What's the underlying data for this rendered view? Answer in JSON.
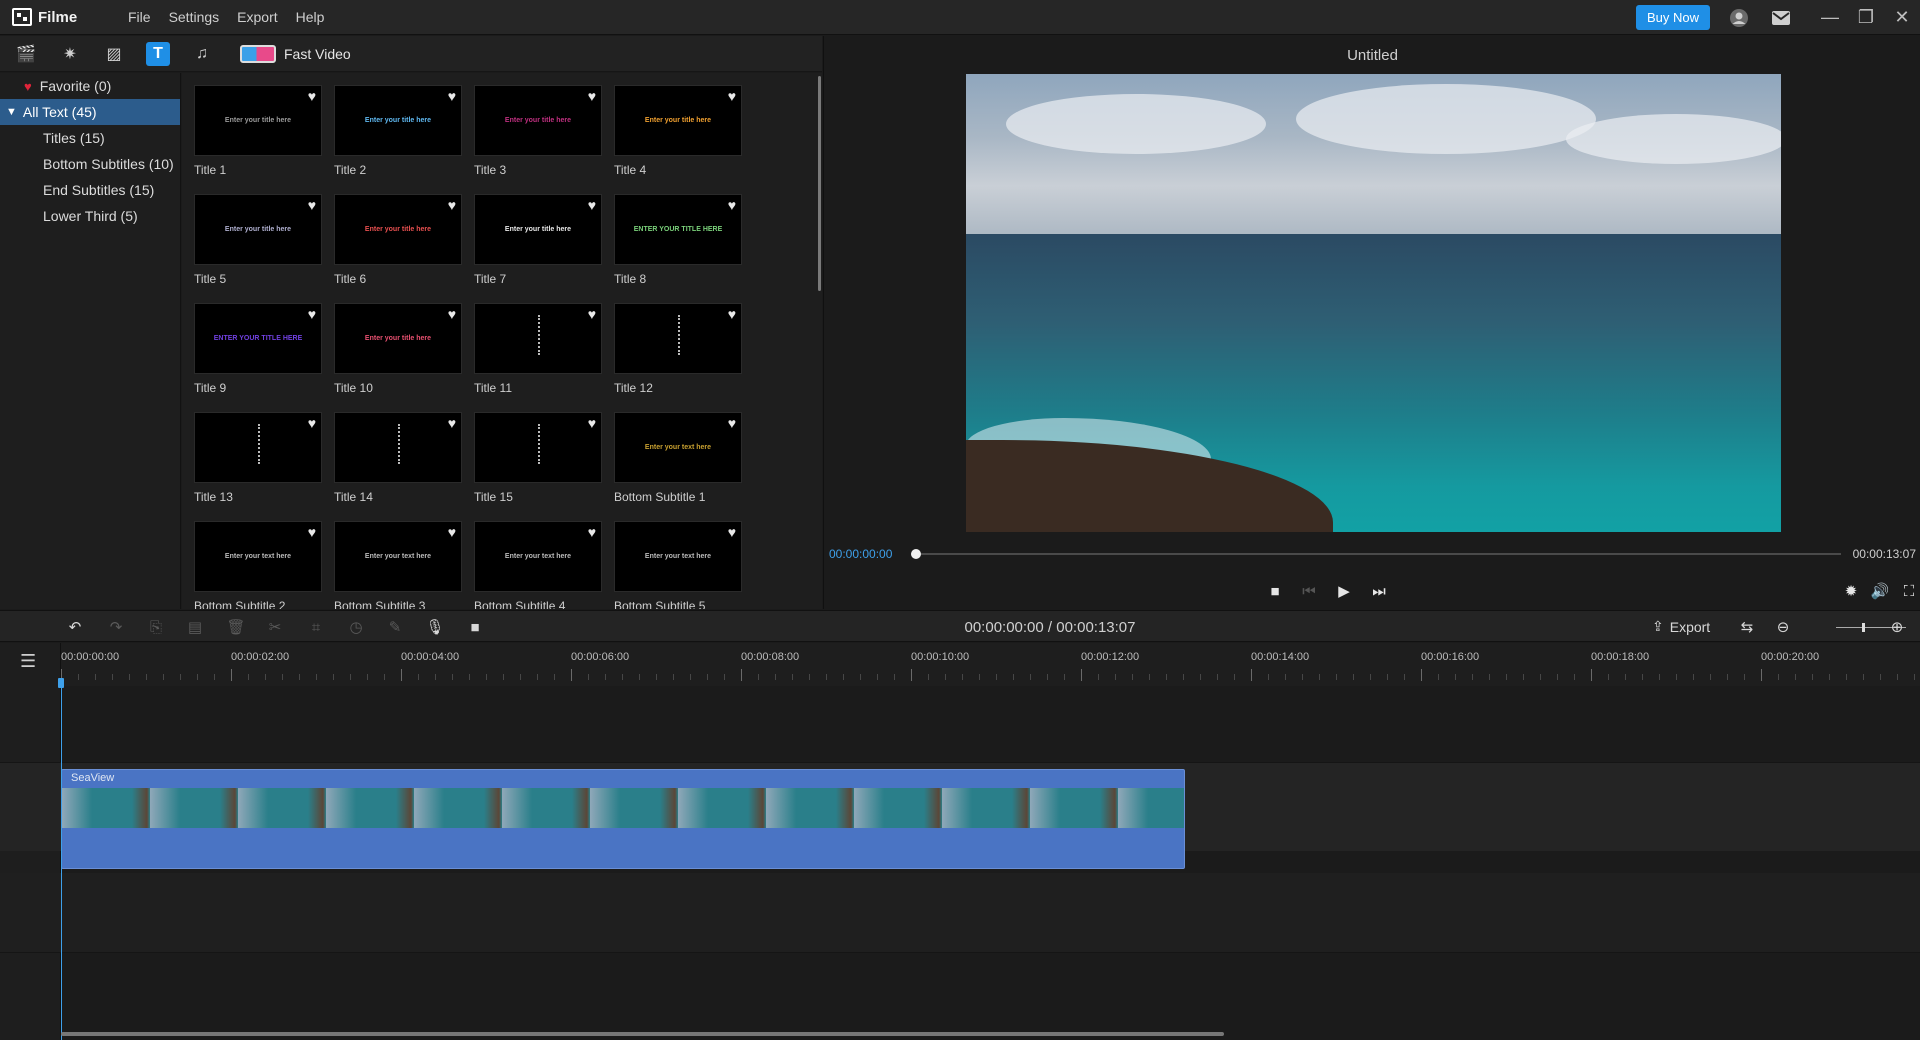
{
  "app": {
    "name": "Filme",
    "menu": [
      "File",
      "Settings",
      "Export",
      "Help"
    ],
    "buy_label": "Buy Now",
    "accent": "#1f8fe6"
  },
  "toolbar": {
    "fast_video_label": "Fast Video"
  },
  "categories": {
    "favorite": "Favorite (0)",
    "all": "All Text (45)",
    "items": [
      "Titles (15)",
      "Bottom Subtitles (10)",
      "End Subtitles (15)",
      "Lower Third (5)"
    ]
  },
  "tiles": [
    {
      "label": "Title 1",
      "text": "Enter your title here",
      "color": "#9a9a9a"
    },
    {
      "label": "Title 2",
      "text": "Enter your title here",
      "color": "#5fb8f0"
    },
    {
      "label": "Title 3",
      "text": "Enter your title here",
      "color": "#c03080"
    },
    {
      "label": "Title 4",
      "text": "Enter your title here",
      "color": "#f0a030"
    },
    {
      "label": "Title 5",
      "text": "Enter your title here",
      "color": "#b0b0d0"
    },
    {
      "label": "Title 6",
      "text": "Enter your title here",
      "color": "#e85050"
    },
    {
      "label": "Title 7",
      "text": "Enter your title here",
      "color": "#e8e8e8"
    },
    {
      "label": "Title 8",
      "text": "ENTER YOUR TITLE HERE",
      "color": "#7ad07a"
    },
    {
      "label": "Title 9",
      "text": "ENTER YOUR TITLE HERE",
      "color": "#7040e0"
    },
    {
      "label": "Title 10",
      "text": "Enter your title here",
      "color": "#e85070"
    },
    {
      "label": "Title 11",
      "text": "",
      "color": "#bbbbbb"
    },
    {
      "label": "Title 12",
      "text": "",
      "color": "#bbbbbb"
    },
    {
      "label": "Title 13",
      "text": "",
      "color": "#bbbbbb"
    },
    {
      "label": "Title 14",
      "text": "",
      "color": "#bbbbbb"
    },
    {
      "label": "Title 15",
      "text": "",
      "color": "#bbbbbb"
    },
    {
      "label": "Bottom Subtitle 1",
      "text": "Enter your text here",
      "color": "#c8a030"
    },
    {
      "label": "Bottom Subtitle 2",
      "text": "Enter your text here",
      "color": "#bbbbbb"
    },
    {
      "label": "Bottom Subtitle 3",
      "text": "Enter your text here",
      "color": "#bbbbbb"
    },
    {
      "label": "Bottom Subtitle 4",
      "text": "Enter your text here",
      "color": "#bbbbbb"
    },
    {
      "label": "Bottom Subtitle 5",
      "text": "Enter your text here",
      "color": "#bbbbbb"
    }
  ],
  "preview": {
    "title": "Untitled",
    "time_current": "00:00:00:00",
    "time_total": "00:00:13:07"
  },
  "timeline": {
    "time_display": "00:00:00:00 / 00:00:13:07",
    "export_label": "Export",
    "ruler_labels": [
      "00:00:00:00",
      "00:00:02:00",
      "00:00:04:00",
      "00:00:06:00",
      "00:00:08:00",
      "00:00:10:00",
      "00:00:12:00",
      "00:00:14:00",
      "00:00:16:00",
      "00:00:18:00",
      "00:00:20:00"
    ],
    "clip_name": "SeaView"
  }
}
